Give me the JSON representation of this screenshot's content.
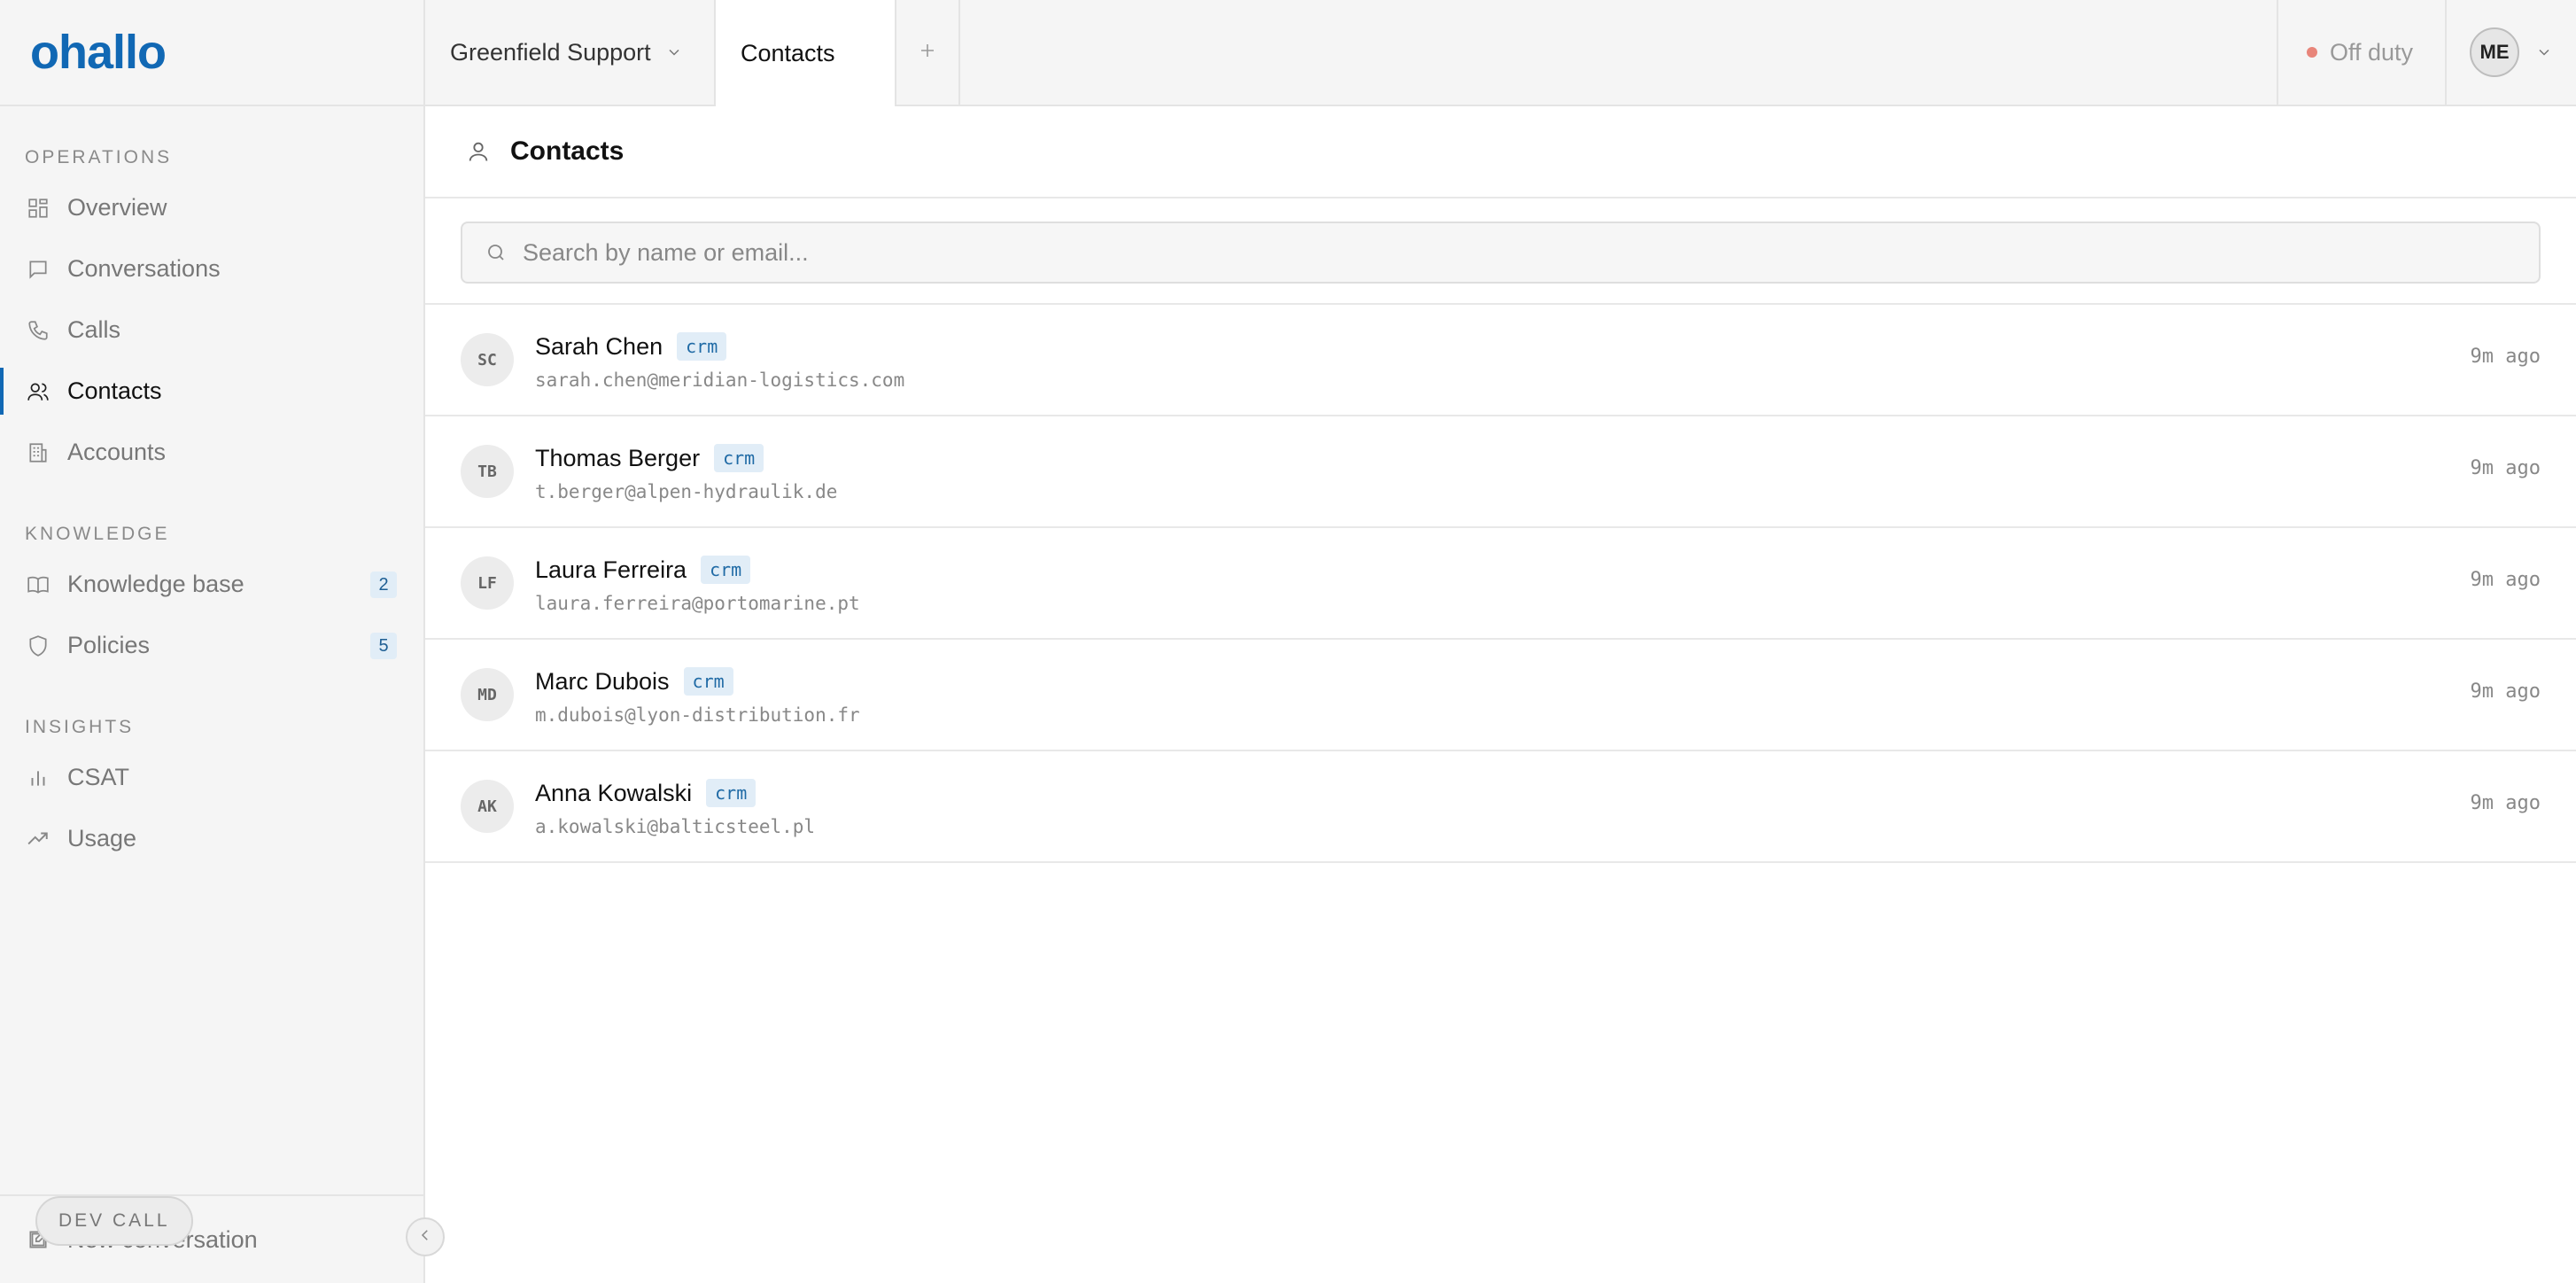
{
  "brand": {
    "logo": "ohallo",
    "accent": "#1168b4"
  },
  "sidebar": {
    "sections": [
      {
        "label": "OPERATIONS",
        "items": [
          {
            "label": "Overview",
            "icon": "grid-icon"
          },
          {
            "label": "Conversations",
            "icon": "chat-icon"
          },
          {
            "label": "Calls",
            "icon": "phone-icon"
          },
          {
            "label": "Contacts",
            "icon": "users-icon",
            "active": true
          },
          {
            "label": "Accounts",
            "icon": "building-icon"
          }
        ]
      },
      {
        "label": "KNOWLEDGE",
        "items": [
          {
            "label": "Knowledge base",
            "icon": "book-icon",
            "badge": "2"
          },
          {
            "label": "Policies",
            "icon": "shield-icon",
            "badge": "5"
          }
        ]
      },
      {
        "label": "INSIGHTS",
        "items": [
          {
            "label": "CSAT",
            "icon": "bar-chart-icon"
          },
          {
            "label": "Usage",
            "icon": "trend-icon"
          }
        ]
      }
    ],
    "bottom_action": "New conversation",
    "dev_call_label": "DEV CALL"
  },
  "topbar": {
    "workspace": "Greenfield Support",
    "active_tab": "Contacts",
    "status": "Off duty",
    "status_color": "#e8857a",
    "user_initials": "ME"
  },
  "main": {
    "title": "Contacts",
    "search_placeholder": "Search by name or email...",
    "contacts": [
      {
        "initials": "SC",
        "name": "Sarah Chen",
        "tag": "crm",
        "email": "sarah.chen@meridian-logistics.com",
        "time": "9m ago"
      },
      {
        "initials": "TB",
        "name": "Thomas Berger",
        "tag": "crm",
        "email": "t.berger@alpen-hydraulik.de",
        "time": "9m ago"
      },
      {
        "initials": "LF",
        "name": "Laura Ferreira",
        "tag": "crm",
        "email": "laura.ferreira@portomarine.pt",
        "time": "9m ago"
      },
      {
        "initials": "MD",
        "name": "Marc Dubois",
        "tag": "crm",
        "email": "m.dubois@lyon-distribution.fr",
        "time": "9m ago"
      },
      {
        "initials": "AK",
        "name": "Anna Kowalski",
        "tag": "crm",
        "email": "a.kowalski@balticsteel.pl",
        "time": "9m ago"
      }
    ]
  }
}
